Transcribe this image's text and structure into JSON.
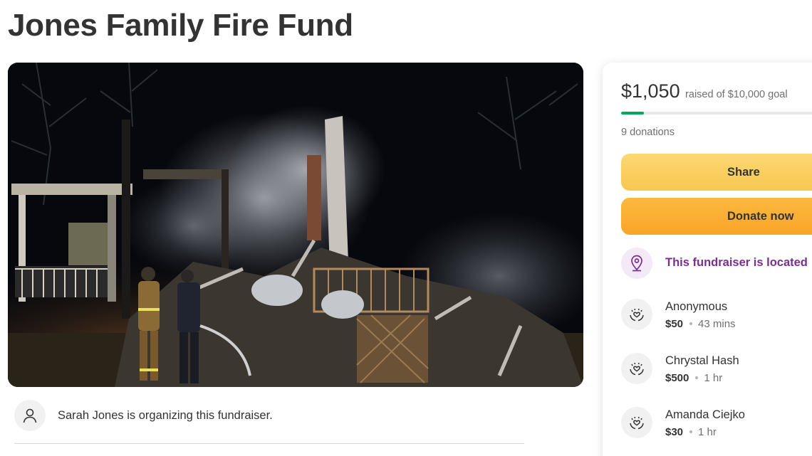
{
  "page": {
    "title": "Jones Family Fire Fund"
  },
  "hero": {
    "image": "night-house-fire-firefighters-photo"
  },
  "organizer": {
    "text": "Sarah Jones is organizing this fundraiser.",
    "icon": "person-icon"
  },
  "summary": {
    "raised": "$1,050",
    "goal_text": "raised of $10,000 goal",
    "progress_fraction": 0.105,
    "donations": "9 donations"
  },
  "actions": {
    "share_label": "Share",
    "donate_label": "Donate now"
  },
  "location": {
    "text": "This fundraiser is located",
    "icon": "location-pin-icon"
  },
  "donors": [
    {
      "name": "Anonymous",
      "amount": "$50",
      "time": "43 mins",
      "icon": "heart-hands-icon"
    },
    {
      "name": "Chrystal Hash",
      "amount": "$500",
      "time": "1 hr",
      "icon": "heart-hands-icon"
    },
    {
      "name": "Amanda Ciejko",
      "amount": "$30",
      "time": "1 hr",
      "icon": "heart-hands-icon"
    }
  ],
  "colors": {
    "progress_green": "#02a95c",
    "share_yellow": "#f7c74f",
    "donate_orange": "#f8a528",
    "location_purple": "#7a2e8e"
  }
}
